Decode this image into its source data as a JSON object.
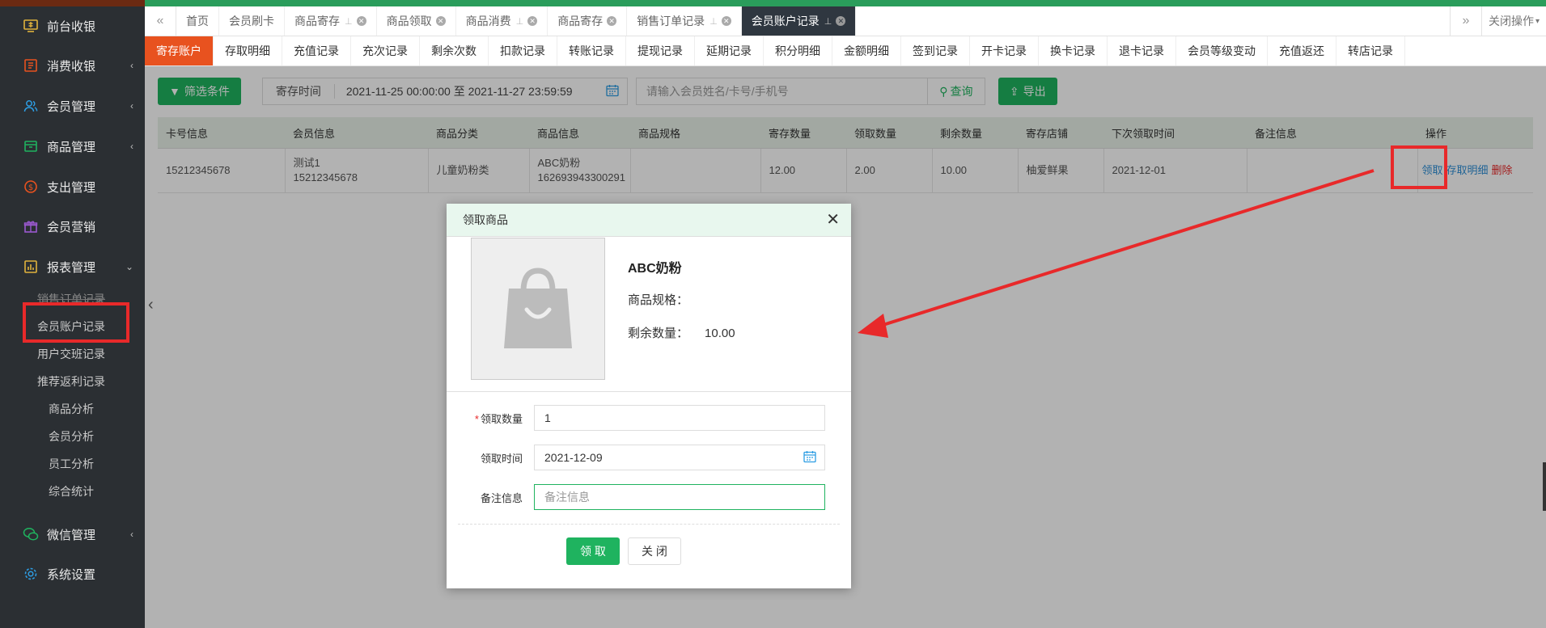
{
  "sidebar": {
    "items": [
      {
        "label": "前台收银",
        "icon": "monitor-icon",
        "arrow": ""
      },
      {
        "label": "消费收银",
        "icon": "receipt-icon",
        "arrow": "‹"
      },
      {
        "label": "会员管理",
        "icon": "users-icon",
        "arrow": "‹"
      },
      {
        "label": "商品管理",
        "icon": "box-icon",
        "arrow": "‹"
      },
      {
        "label": "支出管理",
        "icon": "coin-icon",
        "arrow": ""
      },
      {
        "label": "会员营销",
        "icon": "gift-icon",
        "arrow": ""
      },
      {
        "label": "报表管理",
        "icon": "report-icon",
        "arrow": "⌄"
      },
      {
        "label": "微信管理",
        "icon": "wechat-icon",
        "arrow": "‹"
      },
      {
        "label": "系统设置",
        "icon": "gear-icon",
        "arrow": ""
      }
    ],
    "subitems": [
      "销售订单记录",
      "会员账户记录",
      "用户交班记录",
      "推荐返利记录",
      "商品分析",
      "会员分析",
      "员工分析",
      "综合统计"
    ]
  },
  "tabs": [
    {
      "label": "首页",
      "pin": false,
      "close": false
    },
    {
      "label": "会员刷卡",
      "pin": false,
      "close": false
    },
    {
      "label": "商品寄存",
      "pin": true,
      "close": true
    },
    {
      "label": "商品领取",
      "pin": false,
      "close": true
    },
    {
      "label": "商品消费",
      "pin": true,
      "close": true
    },
    {
      "label": "商品寄存",
      "pin": false,
      "close": true
    },
    {
      "label": "销售订单记录",
      "pin": true,
      "close": true
    },
    {
      "label": "会员账户记录",
      "pin": true,
      "close": true
    }
  ],
  "tabbar": {
    "close_ops": "关闭操作"
  },
  "subtabs": [
    "寄存账户",
    "存取明细",
    "充值记录",
    "充次记录",
    "剩余次数",
    "扣款记录",
    "转账记录",
    "提现记录",
    "延期记录",
    "积分明细",
    "金额明细",
    "签到记录",
    "开卡记录",
    "换卡记录",
    "退卡记录",
    "会员等级变动",
    "充值返还",
    "转店记录"
  ],
  "toolbar": {
    "filter": "筛选条件",
    "date_label": "寄存时间",
    "date_range": "2021-11-25 00:00:00 至 2021-11-27 23:59:59",
    "search_placeholder": "请输入会员姓名/卡号/手机号",
    "search": "查询",
    "export": "导出"
  },
  "table": {
    "headers": [
      "卡号信息",
      "会员信息",
      "商品分类",
      "商品信息",
      "商品规格",
      "寄存数量",
      "领取数量",
      "剩余数量",
      "寄存店铺",
      "下次领取时间",
      "备注信息",
      "操作"
    ],
    "row": {
      "card": "15212345678",
      "member_name": "测试1",
      "member_phone": "15212345678",
      "category": "儿童奶粉类",
      "product_name": "ABC奶粉",
      "product_code": "162693943300291",
      "spec": "",
      "deposit_qty": "12.00",
      "taken_qty": "2.00",
      "remain_qty": "10.00",
      "shop": "柚爱鲜果",
      "next_time": "2021-12-01",
      "note": "",
      "op_take": "领取",
      "op_detail": "存取明细",
      "op_delete": "删除"
    }
  },
  "modal": {
    "title": "领取商品",
    "product_name": "ABC奶粉",
    "spec_label": "商品规格：",
    "remain_label": "剩余数量：",
    "remain_value": "10.00",
    "qty_label": "领取数量",
    "qty_value": "1",
    "time_label": "领取时间",
    "time_value": "2021-12-09",
    "note_label": "备注信息",
    "note_placeholder": "备注信息",
    "ok": "领 取",
    "close": "关 闭"
  },
  "colors": {
    "accent_green": "#1fb35f",
    "active_orange": "#e8521f",
    "highlight_red": "#e8292a"
  }
}
